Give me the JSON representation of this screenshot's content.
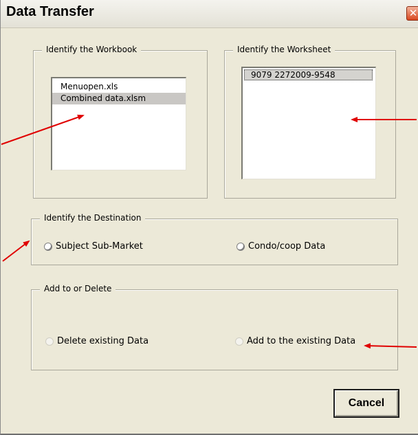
{
  "window": {
    "title": "Data Transfer",
    "close_icon": "close-icon"
  },
  "workbook_group": {
    "legend": "Identify the Workbook",
    "items": [
      {
        "label": "Menuopen.xls",
        "selected": false
      },
      {
        "label": "Combined data.xlsm",
        "selected": true
      }
    ]
  },
  "worksheet_group": {
    "legend": "Identify the Worksheet",
    "items": [
      {
        "label": "9079  2272009-9548",
        "selected": true
      }
    ]
  },
  "destination_group": {
    "legend": "Identify the Destination",
    "options": [
      {
        "label": "Subject Sub-Market"
      },
      {
        "label": "Condo/coop Data"
      }
    ]
  },
  "action_group": {
    "legend": "Add to or Delete",
    "options": [
      {
        "label": "Delete existing Data"
      },
      {
        "label": "Add to the existing Data"
      }
    ]
  },
  "buttons": {
    "cancel_label": "Cancel"
  },
  "annotation_color": "#e00000"
}
